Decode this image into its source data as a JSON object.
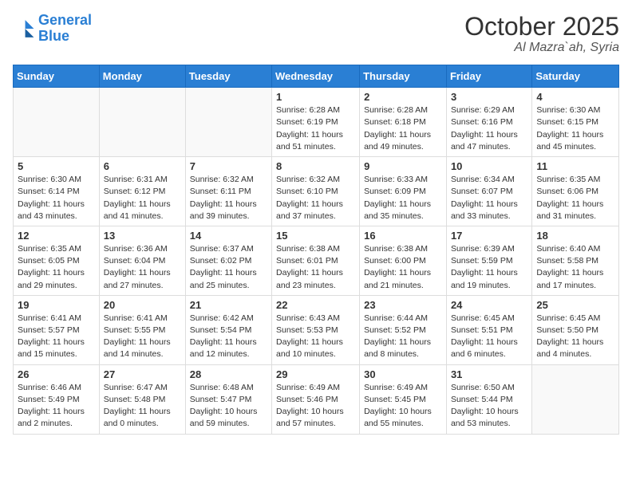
{
  "header": {
    "logo_line1": "General",
    "logo_line2": "Blue",
    "main_title": "October 2025",
    "sub_title": "Al Mazra`ah, Syria"
  },
  "weekdays": [
    "Sunday",
    "Monday",
    "Tuesday",
    "Wednesday",
    "Thursday",
    "Friday",
    "Saturday"
  ],
  "weeks": [
    [
      {
        "day": "",
        "info": ""
      },
      {
        "day": "",
        "info": ""
      },
      {
        "day": "",
        "info": ""
      },
      {
        "day": "1",
        "info": "Sunrise: 6:28 AM\nSunset: 6:19 PM\nDaylight: 11 hours\nand 51 minutes."
      },
      {
        "day": "2",
        "info": "Sunrise: 6:28 AM\nSunset: 6:18 PM\nDaylight: 11 hours\nand 49 minutes."
      },
      {
        "day": "3",
        "info": "Sunrise: 6:29 AM\nSunset: 6:16 PM\nDaylight: 11 hours\nand 47 minutes."
      },
      {
        "day": "4",
        "info": "Sunrise: 6:30 AM\nSunset: 6:15 PM\nDaylight: 11 hours\nand 45 minutes."
      }
    ],
    [
      {
        "day": "5",
        "info": "Sunrise: 6:30 AM\nSunset: 6:14 PM\nDaylight: 11 hours\nand 43 minutes."
      },
      {
        "day": "6",
        "info": "Sunrise: 6:31 AM\nSunset: 6:12 PM\nDaylight: 11 hours\nand 41 minutes."
      },
      {
        "day": "7",
        "info": "Sunrise: 6:32 AM\nSunset: 6:11 PM\nDaylight: 11 hours\nand 39 minutes."
      },
      {
        "day": "8",
        "info": "Sunrise: 6:32 AM\nSunset: 6:10 PM\nDaylight: 11 hours\nand 37 minutes."
      },
      {
        "day": "9",
        "info": "Sunrise: 6:33 AM\nSunset: 6:09 PM\nDaylight: 11 hours\nand 35 minutes."
      },
      {
        "day": "10",
        "info": "Sunrise: 6:34 AM\nSunset: 6:07 PM\nDaylight: 11 hours\nand 33 minutes."
      },
      {
        "day": "11",
        "info": "Sunrise: 6:35 AM\nSunset: 6:06 PM\nDaylight: 11 hours\nand 31 minutes."
      }
    ],
    [
      {
        "day": "12",
        "info": "Sunrise: 6:35 AM\nSunset: 6:05 PM\nDaylight: 11 hours\nand 29 minutes."
      },
      {
        "day": "13",
        "info": "Sunrise: 6:36 AM\nSunset: 6:04 PM\nDaylight: 11 hours\nand 27 minutes."
      },
      {
        "day": "14",
        "info": "Sunrise: 6:37 AM\nSunset: 6:02 PM\nDaylight: 11 hours\nand 25 minutes."
      },
      {
        "day": "15",
        "info": "Sunrise: 6:38 AM\nSunset: 6:01 PM\nDaylight: 11 hours\nand 23 minutes."
      },
      {
        "day": "16",
        "info": "Sunrise: 6:38 AM\nSunset: 6:00 PM\nDaylight: 11 hours\nand 21 minutes."
      },
      {
        "day": "17",
        "info": "Sunrise: 6:39 AM\nSunset: 5:59 PM\nDaylight: 11 hours\nand 19 minutes."
      },
      {
        "day": "18",
        "info": "Sunrise: 6:40 AM\nSunset: 5:58 PM\nDaylight: 11 hours\nand 17 minutes."
      }
    ],
    [
      {
        "day": "19",
        "info": "Sunrise: 6:41 AM\nSunset: 5:57 PM\nDaylight: 11 hours\nand 15 minutes."
      },
      {
        "day": "20",
        "info": "Sunrise: 6:41 AM\nSunset: 5:55 PM\nDaylight: 11 hours\nand 14 minutes."
      },
      {
        "day": "21",
        "info": "Sunrise: 6:42 AM\nSunset: 5:54 PM\nDaylight: 11 hours\nand 12 minutes."
      },
      {
        "day": "22",
        "info": "Sunrise: 6:43 AM\nSunset: 5:53 PM\nDaylight: 11 hours\nand 10 minutes."
      },
      {
        "day": "23",
        "info": "Sunrise: 6:44 AM\nSunset: 5:52 PM\nDaylight: 11 hours\nand 8 minutes."
      },
      {
        "day": "24",
        "info": "Sunrise: 6:45 AM\nSunset: 5:51 PM\nDaylight: 11 hours\nand 6 minutes."
      },
      {
        "day": "25",
        "info": "Sunrise: 6:45 AM\nSunset: 5:50 PM\nDaylight: 11 hours\nand 4 minutes."
      }
    ],
    [
      {
        "day": "26",
        "info": "Sunrise: 6:46 AM\nSunset: 5:49 PM\nDaylight: 11 hours\nand 2 minutes."
      },
      {
        "day": "27",
        "info": "Sunrise: 6:47 AM\nSunset: 5:48 PM\nDaylight: 11 hours\nand 0 minutes."
      },
      {
        "day": "28",
        "info": "Sunrise: 6:48 AM\nSunset: 5:47 PM\nDaylight: 10 hours\nand 59 minutes."
      },
      {
        "day": "29",
        "info": "Sunrise: 6:49 AM\nSunset: 5:46 PM\nDaylight: 10 hours\nand 57 minutes."
      },
      {
        "day": "30",
        "info": "Sunrise: 6:49 AM\nSunset: 5:45 PM\nDaylight: 10 hours\nand 55 minutes."
      },
      {
        "day": "31",
        "info": "Sunrise: 6:50 AM\nSunset: 5:44 PM\nDaylight: 10 hours\nand 53 minutes."
      },
      {
        "day": "",
        "info": ""
      }
    ]
  ]
}
